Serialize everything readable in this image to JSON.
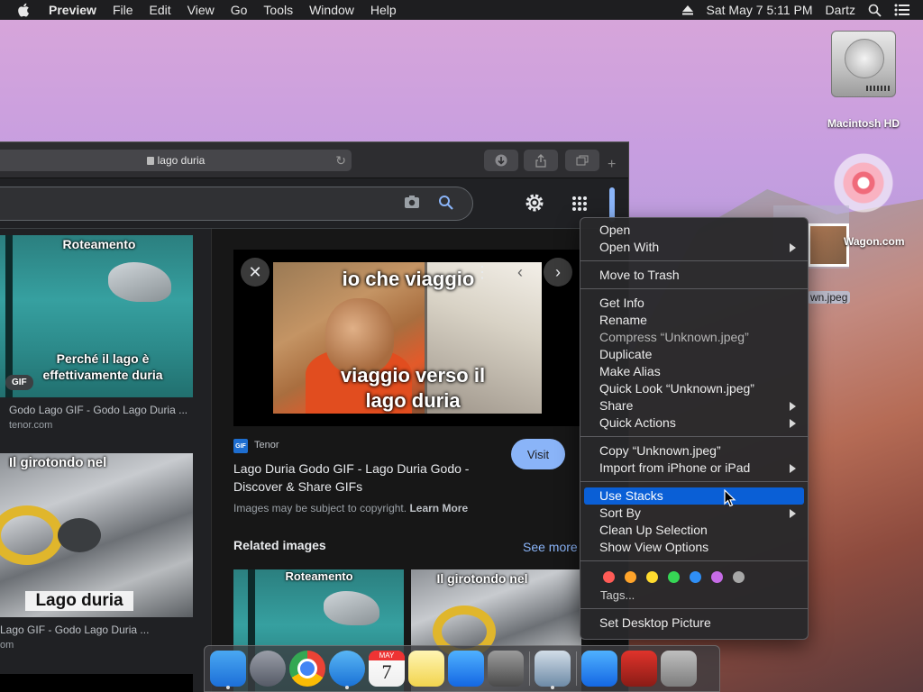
{
  "menubar": {
    "app_name": "Preview",
    "items": [
      "File",
      "Edit",
      "View",
      "Go",
      "Tools",
      "Window",
      "Help"
    ],
    "datetime": "Sat May 7  5:11 PM",
    "user": "Dartz",
    "icons": [
      "apple-icon",
      "eject-icon",
      "spotlight-icon",
      "notification-center-icon"
    ]
  },
  "desktop": {
    "hd_label": "Macintosh HD",
    "wagon_label": "Wagon.com",
    "unknown_label": "wn.jpeg"
  },
  "browser": {
    "address": "lago duria",
    "results": [
      {
        "overlay_top": "Roteamento",
        "overlay_bottom": "Perché il lago è effettivamente duria",
        "badge": "GIF",
        "title": "Godo Lago GIF - Godo Lago Duria ...",
        "source": "tenor.com"
      },
      {
        "overlay_top": "Il girotondo nel",
        "overlay_bottom": "Lago duria",
        "title": "Lago GIF - Godo Lago Duria ...",
        "source": "om"
      }
    ],
    "panel": {
      "caption_top": "io che viaggio",
      "caption_bottom": "viaggio verso il lago duria",
      "source_name": "Tenor",
      "source_logo": "GIF",
      "visit_label": "Visit",
      "title": "Lago Duria Godo GIF - Lago Duria Godo - Discover & Share GIFs",
      "copyright": "Images may be subject to copyright.",
      "learn_more": "Learn More",
      "related_title": "Related images",
      "see_more": "See more",
      "related": [
        {
          "overlay": "Roteamento"
        },
        {
          "overlay": "Il girotondo nel"
        }
      ]
    }
  },
  "context_menu": {
    "groups": [
      [
        {
          "label": "Open"
        },
        {
          "label": "Open With",
          "submenu": true
        }
      ],
      [
        {
          "label": "Move to Trash"
        }
      ],
      [
        {
          "label": "Get Info"
        },
        {
          "label": "Rename"
        },
        {
          "label": "Compress “Unknown.jpeg”",
          "disabled": true
        },
        {
          "label": "Duplicate"
        },
        {
          "label": "Make Alias"
        },
        {
          "label": "Quick Look “Unknown.jpeg”"
        },
        {
          "label": "Share",
          "submenu": true
        },
        {
          "label": "Quick Actions",
          "submenu": true
        }
      ],
      [
        {
          "label": "Copy “Unknown.jpeg”"
        },
        {
          "label": "Import from iPhone or iPad",
          "submenu": true
        }
      ],
      [
        {
          "label": "Use Stacks",
          "highlight": true
        },
        {
          "label": "Sort By",
          "submenu": true
        },
        {
          "label": "Clean Up Selection"
        },
        {
          "label": "Show View Options"
        }
      ]
    ],
    "tag_colors": [
      "#ff5b56",
      "#ffa42a",
      "#ffdb2e",
      "#36d655",
      "#2f8ef5",
      "#c66be6",
      "#a7a7a7"
    ],
    "tags_label": "Tags...",
    "last": "Set Desktop Picture"
  },
  "dock": {
    "apps": [
      {
        "name": "finder",
        "colors": [
          "#4aa8f2",
          "#1c6fd8"
        ],
        "running": true
      },
      {
        "name": "launchpad",
        "colors": [
          "#9a9ea8",
          "#555a66"
        ],
        "running": false
      },
      {
        "name": "chrome",
        "colors": [
          "#ffffff",
          "#dddddd"
        ],
        "running": false
      },
      {
        "name": "safari",
        "colors": [
          "#59b6f5",
          "#1a72d6"
        ],
        "running": true
      },
      {
        "name": "calendar",
        "colors": [
          "#ffffff",
          "#eeeeee"
        ],
        "running": false
      },
      {
        "name": "notes",
        "colors": [
          "#fff5b3",
          "#f2d44e"
        ],
        "running": false
      },
      {
        "name": "app-store",
        "colors": [
          "#4fb1ff",
          "#1467e3"
        ],
        "running": false
      },
      {
        "name": "system-preferences",
        "colors": [
          "#9b9b9b",
          "#4a4a4a"
        ],
        "running": false
      },
      {
        "name": "preview",
        "colors": [
          "#d2dde8",
          "#6d8aa6"
        ],
        "running": true
      },
      {
        "name": "app-store-2",
        "colors": [
          "#4fb1ff",
          "#1467e3"
        ],
        "running": false
      },
      {
        "name": "photo-booth",
        "colors": [
          "#e0332b",
          "#8a1c16"
        ],
        "running": false
      },
      {
        "name": "trash",
        "colors": [
          "#bfbfbf",
          "#7d7d7d"
        ],
        "running": false
      }
    ],
    "calendar_month": "MAY",
    "calendar_day": "7"
  }
}
